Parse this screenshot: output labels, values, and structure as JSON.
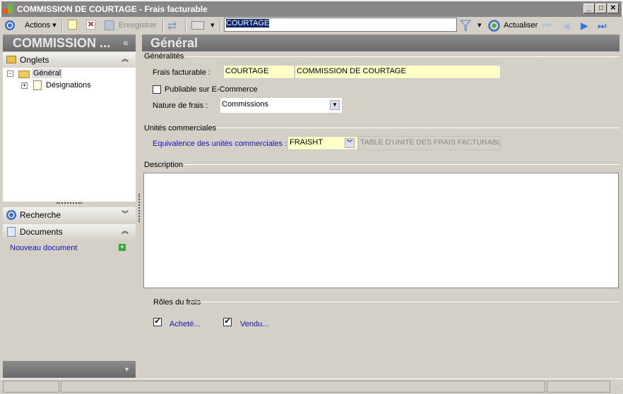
{
  "window": {
    "title": "COMMISSION DE COURTAGE -  Frais facturable"
  },
  "toolbar": {
    "actions": "Actions",
    "save": "Enregistrer",
    "search_value": "COURTAGE",
    "refresh": "Actualiser"
  },
  "sidebar": {
    "title": "COMMISSION ...",
    "collapse": "«",
    "onglets": "Onglets",
    "tree": [
      {
        "label": "Général"
      },
      {
        "label": "Désignations"
      }
    ],
    "recherche": "Recherche",
    "documents": "Documents",
    "new_document": "Nouveau document"
  },
  "main": {
    "title": "Général",
    "generalites": "Généralités",
    "frais_label": "Frais facturable :",
    "frais_code": "COURTAGE",
    "frais_name": "COMMISSION DE COURTAGE",
    "publiable": "Publiable sur E-Commerce",
    "publiable_checked": false,
    "nature_label": "Nature de frais :",
    "nature_value": "Commissions",
    "unites": "Unités commerciales",
    "equiv_label": "Equivalence des unités commerciales :",
    "equiv_code": "FRAISHT",
    "equiv_name": "TABLE D'UNITE DES FRAIS FACTURABLES",
    "description": "Description",
    "roles": "Rôles du frais",
    "achete": "Acheté...",
    "achete_checked": true,
    "vendu": "Vendu...",
    "vendu_checked": true
  }
}
